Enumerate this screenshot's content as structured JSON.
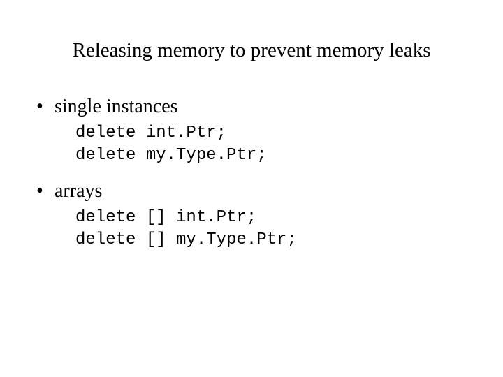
{
  "title": "Releasing memory to prevent memory leaks",
  "bullet_char": "•",
  "items": [
    {
      "label": "single instances",
      "code": "delete int.Ptr;\ndelete my.Type.Ptr;"
    },
    {
      "label": "arrays",
      "code": "delete [] int.Ptr;\ndelete [] my.Type.Ptr;"
    }
  ]
}
